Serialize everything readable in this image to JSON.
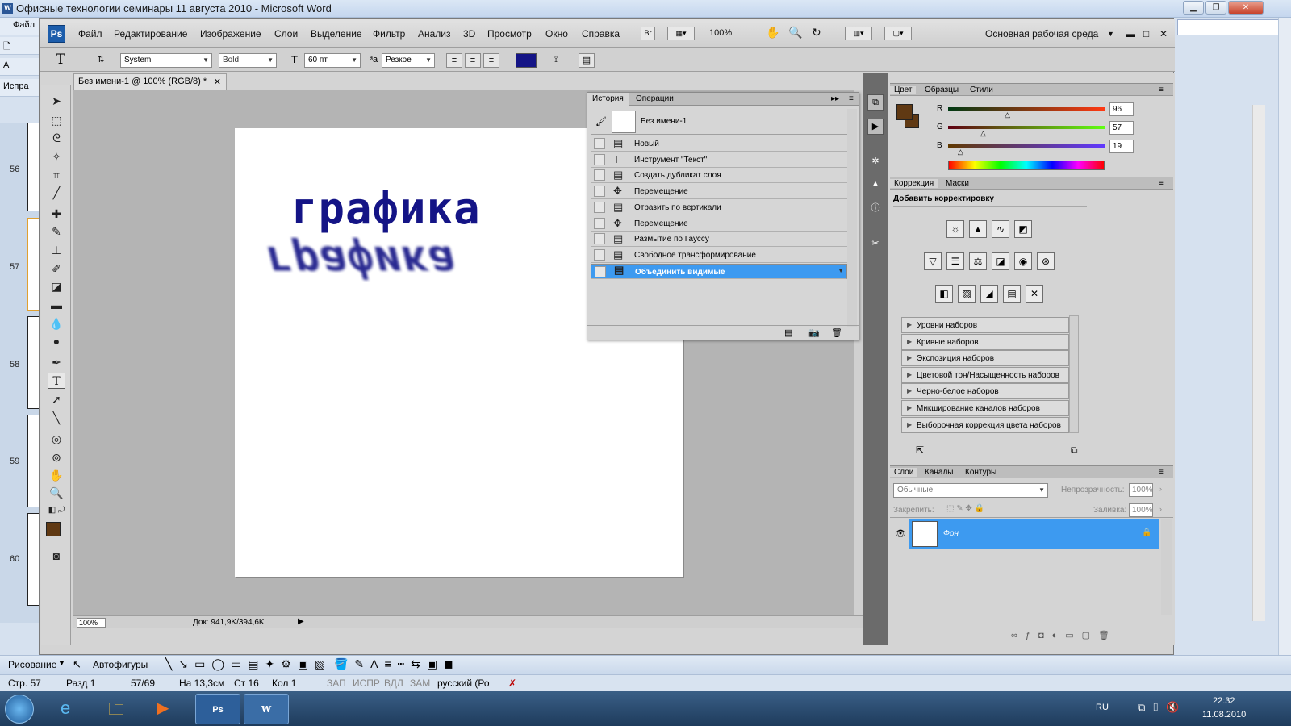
{
  "word": {
    "title": "Офисные технологии семинары 11 августа 2010 - Microsoft Word",
    "file_tab": "Файл",
    "fix_tab": "Испра",
    "pages": [
      "56",
      "57",
      "58",
      "59",
      "60"
    ]
  },
  "ps": {
    "menu": [
      "Файл",
      "Редактирование",
      "Изображение",
      "Слои",
      "Выделение",
      "Фильтр",
      "Анализ",
      "3D",
      "Просмотр",
      "Окно",
      "Справка"
    ],
    "zoom": "100%",
    "workspace": "Основная рабочая среда",
    "options": {
      "font": "System",
      "style": "Bold",
      "size": "60 пт",
      "aa": "Резкое",
      "color": "#141486"
    },
    "doc_tab": "Без имени-1 @ 100% (RGB/8) *",
    "canvas_text": "графика",
    "canvas_text_mirror": "графика",
    "status": {
      "zoom": "100%",
      "doc": "Док: 941,9K/394,6K"
    },
    "history": {
      "tabs": [
        "История",
        "Операции"
      ],
      "snapshot": "Без имени-1",
      "items": [
        "Новый",
        "Инструмент \"Текст\"",
        "Создать дубликат слоя",
        "Перемещение",
        "Отразить по вертикали",
        "Перемещение",
        "Размытие по Гауссу",
        "Свободное трансформирование",
        "Объединить видимые"
      ]
    },
    "color_panel": {
      "tabs": [
        "Цвет",
        "Образцы",
        "Стили"
      ],
      "r": "96",
      "g": "57",
      "b": "19",
      "fg": "#603913",
      "bg": "#603913"
    },
    "correction": {
      "tabs": [
        "Коррекция",
        "Маски"
      ],
      "title": "Добавить корректировку",
      "presets": [
        "Уровни наборов",
        "Кривые наборов",
        "Экспозиция наборов",
        "Цветовой тон/Насыщенность наборов",
        "Черно-белое наборов",
        "Микширование каналов наборов",
        "Выборочная коррекция цвета наборов"
      ]
    },
    "layers": {
      "tabs": [
        "Слои",
        "Каналы",
        "Контуры"
      ],
      "blend": "Обычные",
      "opacity_label": "Непрозрачность:",
      "opacity": "100%",
      "lock_label": "Закрепить:",
      "fill_label": "Заливка:",
      "fill": "100%",
      "layer_name": "Фон"
    }
  },
  "word_bottom": {
    "draw": "Рисование",
    "autoshapes": "Автофигуры",
    "status": {
      "page": "Стр. 57",
      "section": "Разд 1",
      "pages": "57/69",
      "at": "На 13,3см",
      "line": "Ст 16",
      "col": "Кол 1",
      "rec": "ЗАП",
      "trk": "ИСПР",
      "ext": "ВДЛ",
      "ovr": "ЗАМ",
      "lang": "русский (Ро"
    }
  },
  "taskbar": {
    "lang": "RU",
    "time": "22:32",
    "date": "11.08.2010",
    "ps": "Ps",
    "word": "W"
  }
}
